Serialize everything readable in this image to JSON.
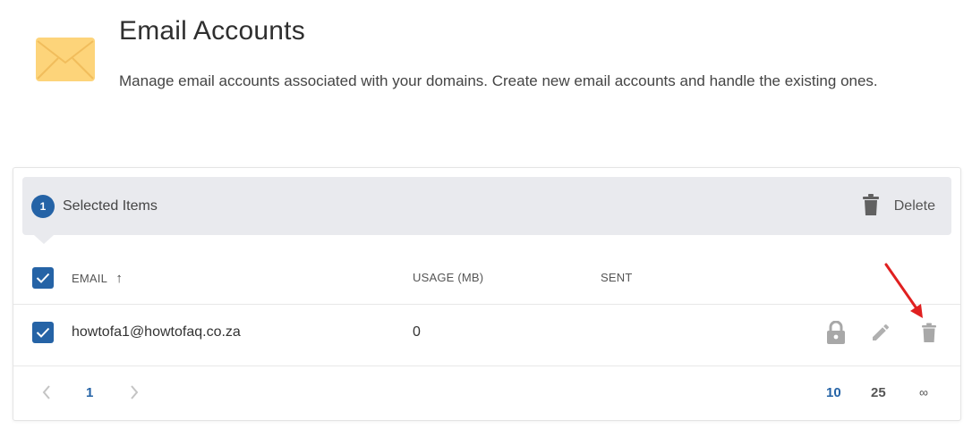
{
  "header": {
    "title": "Email Accounts",
    "description": "Manage email accounts associated with your domains. Create new email accounts and handle the existing ones.",
    "icon": "envelope-icon"
  },
  "selection": {
    "count": "1",
    "label": "Selected Items",
    "delete_label": "Delete"
  },
  "table": {
    "columns": [
      "EMAIL",
      "USAGE (MB)",
      "SENT"
    ],
    "sort_indicator": "↑",
    "rows": [
      {
        "email": "howtofa1@howtofaq.co.za",
        "usage": "0",
        "sent": ""
      }
    ]
  },
  "pagination": {
    "pages": [
      "1"
    ],
    "per_page_options": [
      "10",
      "25",
      "∞"
    ],
    "per_page_selected": "10"
  },
  "colors": {
    "accent": "#2563a6",
    "selection_bar": "#e9eaee",
    "icon_gray": "#9e9e9e",
    "annotation_arrow": "#e02020",
    "envelope": "#fdd47a"
  }
}
